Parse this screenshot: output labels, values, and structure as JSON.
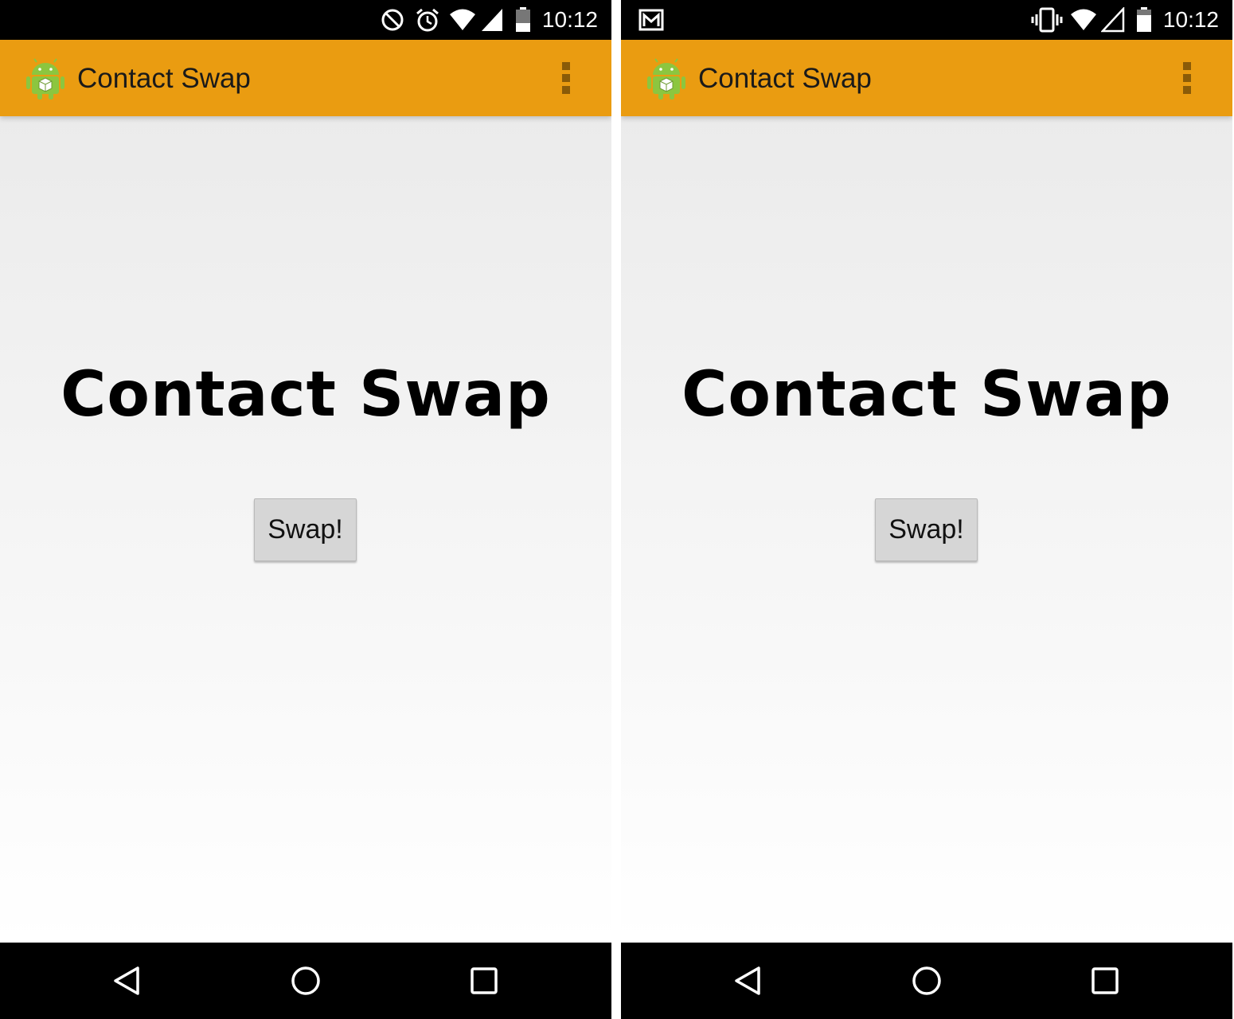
{
  "screens": [
    {
      "status_bar": {
        "time": "10:12",
        "icons": [
          "do-not-disturb-icon",
          "alarm-icon",
          "wifi-icon",
          "cell-signal-icon",
          "battery-icon"
        ]
      },
      "action_bar": {
        "title": "Contact Swap",
        "app_icon": "android-icon",
        "overflow_icon": "overflow-menu-icon"
      },
      "main": {
        "heading": "Contact Swap",
        "swap_button_label": "Swap!"
      },
      "nav_bar": {
        "icons": [
          "back-icon",
          "home-icon",
          "recents-icon"
        ]
      }
    },
    {
      "status_bar": {
        "time": "10:12",
        "icons": [
          "gmail-notification-icon",
          "vibrate-icon",
          "wifi-icon",
          "cell-signal-icon",
          "battery-icon"
        ]
      },
      "action_bar": {
        "title": "Contact Swap",
        "app_icon": "android-icon",
        "overflow_icon": "overflow-menu-icon"
      },
      "main": {
        "heading": "Contact Swap",
        "swap_button_label": "Swap!"
      },
      "nav_bar": {
        "icons": [
          "back-icon",
          "home-icon",
          "recents-icon"
        ]
      }
    }
  ],
  "colors": {
    "action_bar": "#ea9c11",
    "status_bar": "#000000",
    "nav_bar": "#000000",
    "button": "#d6d6d6"
  }
}
